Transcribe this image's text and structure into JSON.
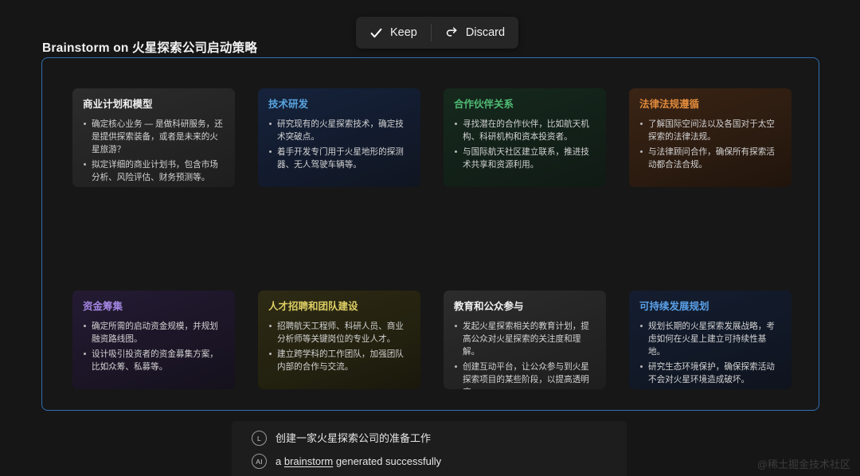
{
  "toolbar": {
    "keep_label": "Keep",
    "discard_label": "Discard",
    "keep_icon": "check-icon",
    "discard_icon": "undo-arrow-icon"
  },
  "header": {
    "title": "Brainstorm on 火星探索公司启动策略"
  },
  "board": {
    "border_color": "#2f6fb5",
    "cards": [
      {
        "title": "商业计划和模型",
        "accent": "#f0f0f0",
        "theme": "gray",
        "bullets": [
          "确定核心业务 — 是做科研服务，还是提供探索装备，或者是未来的火星旅游？",
          "拟定详细的商业计划书，包含市场分析、风险评估、财务预测等。"
        ]
      },
      {
        "title": "技术研发",
        "accent": "#58a4e0",
        "theme": "blue",
        "bullets": [
          "研究现有的火星探索技术，确定技术突破点。",
          "着手开发专门用于火星地形的探测器、无人驾驶车辆等。"
        ]
      },
      {
        "title": "合作伙伴关系",
        "accent": "#4fbb74",
        "theme": "green",
        "bullets": [
          "寻找潜在的合作伙伴，比如航天机构、科研机构和资本投资者。",
          "与国际航天社区建立联系，推进技术共享和资源利用。"
        ]
      },
      {
        "title": "法律法规遵循",
        "accent": "#e08a3c",
        "theme": "orange",
        "bullets": [
          "了解国际空间法以及各国对于太空探索的法律法规。",
          "与法律顾问合作，确保所有探索活动都合法合规。"
        ]
      },
      {
        "title": "资金筹集",
        "accent": "#a285e0",
        "theme": "purple",
        "bullets": [
          "确定所需的启动资金规模，并规划融资路线图。",
          "设计吸引投资者的资金募集方案，比如众筹、私募等。"
        ]
      },
      {
        "title": "人才招聘和团队建设",
        "accent": "#ddcf64",
        "theme": "olive",
        "bullets": [
          "招聘航天工程师、科研人员、商业分析师等关键岗位的专业人才。",
          "建立跨学科的工作团队，加强团队内部的合作与交流。"
        ]
      },
      {
        "title": "教育和公众参与",
        "accent": "#f0f0f0",
        "theme": "gray",
        "bullets": [
          "发起火星探索相关的教育计划，提高公众对火星探索的关注度和理解。",
          "创建互动平台，让公众参与到火星探索项目的某些阶段，以提高透明度。"
        ]
      },
      {
        "title": "可持续发展规划",
        "accent": "#5aa0e8",
        "theme": "navy",
        "bullets": [
          "规划长期的火星探索发展战略，考虑如何在火星上建立可持续性基地。",
          "研究生态环境保护，确保探索活动不会对火星环境造成破坏。"
        ]
      }
    ]
  },
  "footer": {
    "user": {
      "avatar": "L",
      "text": "创建一家火星探索公司的准备工作"
    },
    "ai": {
      "avatar": "AI",
      "prefix": "a ",
      "keyword": "brainstorm",
      "suffix": " generated successfully"
    }
  },
  "watermark": "@稀土掘金技术社区"
}
